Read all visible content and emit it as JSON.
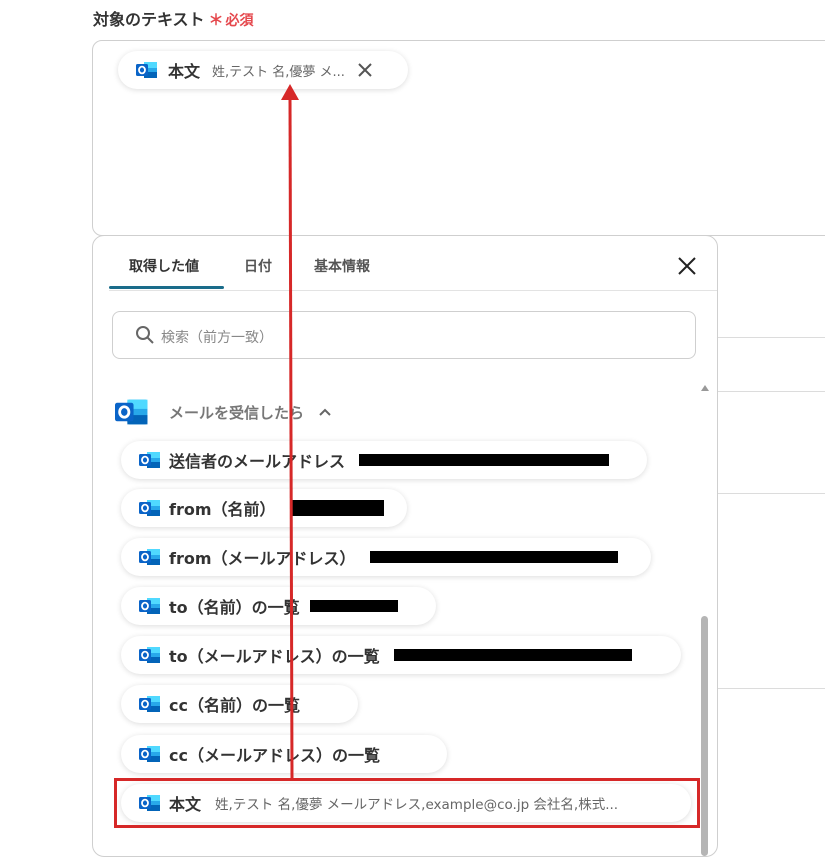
{
  "field": {
    "label": "対象のテキスト",
    "required_mark": "＊",
    "required_text": "必須"
  },
  "selected_chip": {
    "icon": "outlook-icon",
    "label": "本文",
    "value": "姓,テスト 名,優夢 メ..."
  },
  "panel": {
    "tabs": [
      "取得した値",
      "日付",
      "基本情報"
    ],
    "active_tab": "取得した値",
    "search_placeholder": "検索（前方一致）",
    "group_title": "メールを受信したら",
    "items": [
      {
        "label": "送信者のメールアドレス",
        "value": ""
      },
      {
        "label": "from（名前）",
        "value": ""
      },
      {
        "label": "from（メールアドレス）",
        "value": ""
      },
      {
        "label": "to（名前）の一覧",
        "value": ""
      },
      {
        "label": "to（メールアドレス）の一覧",
        "value": ""
      },
      {
        "label": "cc（名前）の一覧",
        "value": ""
      },
      {
        "label": "cc（メールアドレス）の一覧",
        "value": ""
      },
      {
        "label": "本文",
        "value": "姓,テスト 名,優夢 メールアドレス,example@co.jp 会社名,株式..."
      }
    ]
  },
  "colors": {
    "required": "#e5484d",
    "tab_underline": "#1a6c8a",
    "annotation": "#d62828",
    "outlook_blue": "#0a64c8"
  }
}
